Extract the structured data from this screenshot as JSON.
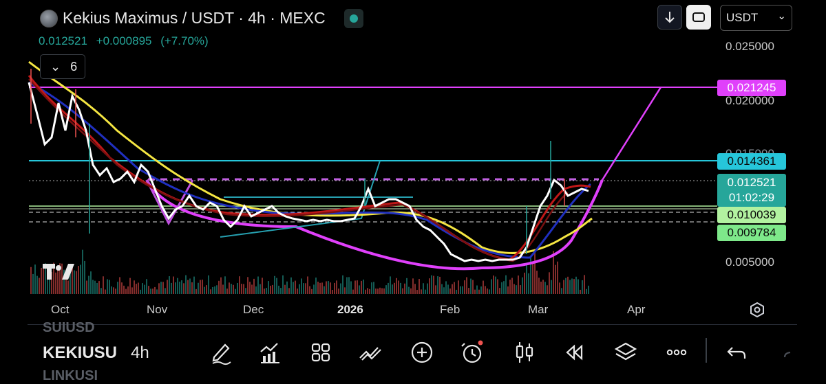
{
  "header": {
    "symbol_title": "Kekius Maximus / USDT · 4h · MEXC",
    "last_price": "0.012521",
    "change": "+0.000895",
    "change_pct": "(+7.70%)"
  },
  "toolbar_top": {
    "currency": "USDT"
  },
  "indicators": {
    "count": "6"
  },
  "price_scale": {
    "ticks": [
      "0.025000",
      "0.020000",
      "0.015000",
      "0.005000"
    ],
    "labels": [
      {
        "value": "0.021245",
        "color": "#e040fb"
      },
      {
        "value": "0.014361",
        "color": "#26c6da"
      },
      {
        "value": "0.012521",
        "sub": "01:02:29",
        "color": "#26a69a"
      },
      {
        "value": "0.010039",
        "color": "#b2f2a0"
      },
      {
        "value": "0.009784",
        "color": "#7ee88a"
      }
    ]
  },
  "time_axis": {
    "ticks": [
      "Oct",
      "Nov",
      "Dec",
      "2026",
      "Feb",
      "Mar",
      "Apr"
    ]
  },
  "watchlist": {
    "prev": "SUIUSD",
    "current": "KEKIUSU",
    "next": "LINKUSI"
  },
  "interval": "4h",
  "colors": {
    "up": "#26a69a",
    "magenta": "#e040fb",
    "cyan": "#26c6da",
    "yellow": "#f5e642"
  },
  "icons": [
    "draw-icon",
    "indicators-icon",
    "templates-icon",
    "compare-icon",
    "add-icon",
    "alert-icon",
    "candles-icon",
    "replay-icon",
    "layers-icon",
    "more-icon",
    "undo-icon"
  ]
}
